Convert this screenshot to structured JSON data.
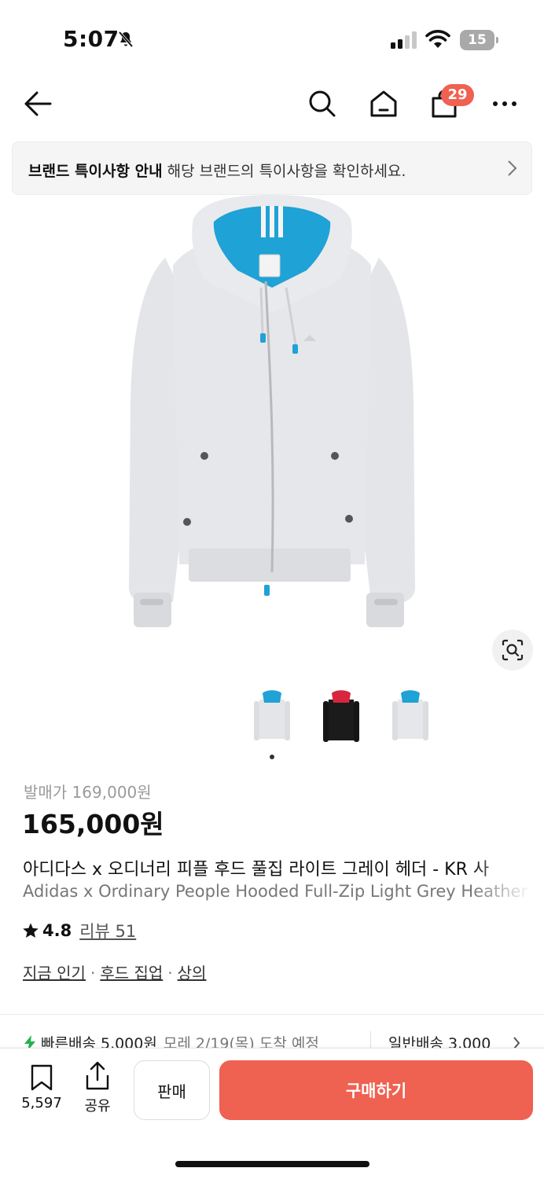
{
  "status_bar": {
    "time": "5:07",
    "battery_level": "15"
  },
  "nav": {
    "cart_count": "29",
    "icons": [
      "back-arrow-icon",
      "search-icon",
      "home-icon",
      "shopping-bag-icon",
      "more-icon"
    ]
  },
  "brand_notice": {
    "bold_text": "브랜드 특이사항 안내",
    "text": "해당 브랜드의 특이사항을 확인하세요."
  },
  "product": {
    "retail_price": "발매가 169,000원",
    "price": "165,000원",
    "title_ko": "아디다스 x 오디너리 피플 후드 풀집 라이트 그레이 헤더 - KR 사",
    "title_en": "Adidas x Ordinary People Hooded Full-Zip Light Grey Heather",
    "rating": "4.8",
    "reviews": "리뷰 51",
    "categories": [
      "지금 인기",
      "후드 집업",
      "상의"
    ],
    "category_separator": "·",
    "thumbnails": [
      {
        "color": "light-grey-blue-hood"
      },
      {
        "color": "black-red-hood"
      },
      {
        "color": "light-grey-blue-hood"
      }
    ]
  },
  "delivery": {
    "fast_label": "빠른배송 5,000원",
    "fast_date": "모레 2/19(목) 도착 예정",
    "normal_label": "일반배송 3,000"
  },
  "bottom_bar": {
    "bookmark_count": "5,597",
    "share_label": "공유",
    "sell_label": "판매",
    "buy_label": "구매하기"
  },
  "colors": {
    "accent": "#ef6150",
    "hood_lining": "#1fa2d6",
    "hoodie": "#e4e5e8",
    "fast_delivery": "#22b14c"
  }
}
